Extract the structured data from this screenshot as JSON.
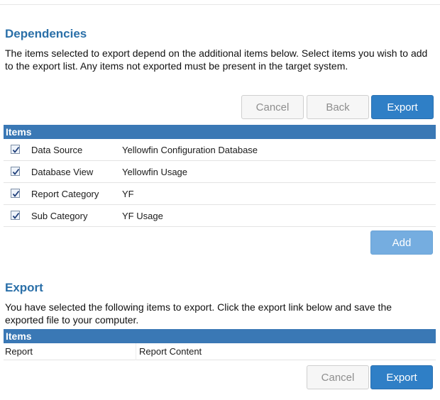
{
  "dependencies": {
    "title": "Dependencies",
    "description": "The items selected to export depend on the additional items below. Select items you wish to add to the export list. Any items not exported must be present in the target system.",
    "buttons": {
      "cancel": "Cancel",
      "back": "Back",
      "export": "Export"
    },
    "table": {
      "header": "Items",
      "rows": [
        {
          "type": "Data Source",
          "name": "Yellowfin Configuration Database",
          "checked": true
        },
        {
          "type": "Database View",
          "name": "Yellowfin Usage",
          "checked": true
        },
        {
          "type": "Report Category",
          "name": "YF",
          "checked": true
        },
        {
          "type": "Sub Category",
          "name": "YF Usage",
          "checked": true
        }
      ]
    },
    "add_button": "Add"
  },
  "export": {
    "title": "Export",
    "description": "You have selected the following items to export. Click the export link below and save the exported file to your computer.",
    "table": {
      "header": "Items",
      "rows": [
        {
          "type": "Report",
          "name": "Report Content"
        }
      ]
    },
    "buttons": {
      "cancel": "Cancel",
      "export": "Export"
    }
  },
  "colors": {
    "title_blue": "#2a6fa8",
    "header_blue": "#3a78b5",
    "primary_button": "#2f7fc6",
    "disabled_button": "#75ade0"
  },
  "icons": [
    "checkbox-checked-icon"
  ]
}
